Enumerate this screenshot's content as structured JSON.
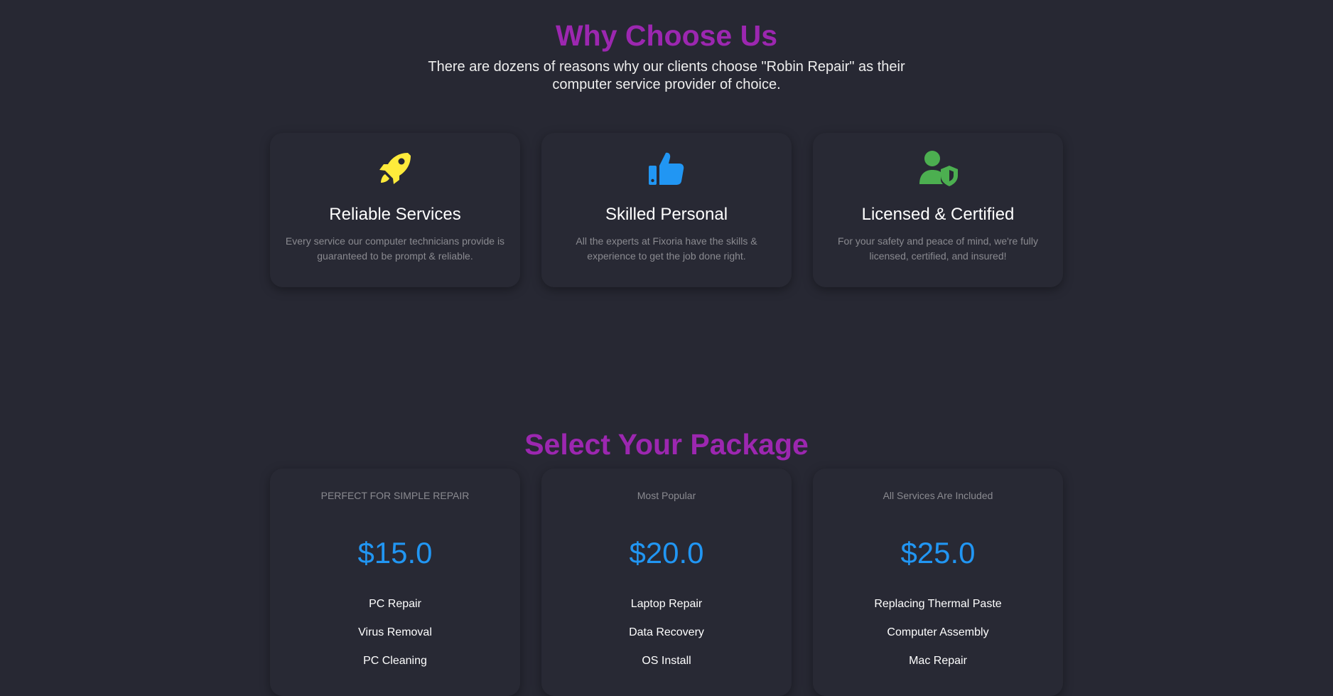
{
  "why_section": {
    "title": "Why Choose Us",
    "subtitle": "There are dozens of reasons why our clients choose \"Robin Repair\" as their computer service provider of choice.",
    "title_color": "#9c27b0",
    "features": [
      {
        "icon": "rocket-icon",
        "icon_color": "#ffeb3b",
        "title": "Reliable Services",
        "description": "Every service our computer technicians provide is guaranteed to be prompt & reliable."
      },
      {
        "icon": "thumbs-up-icon",
        "icon_color": "#2196f3",
        "title": "Skilled Personal",
        "description": "All the experts at Fixoria have the skills & experience to get the job done right."
      },
      {
        "icon": "user-shield-icon",
        "icon_color": "#4caf50",
        "title": "Licensed & Certified",
        "description": "For your safety and peace of mind, we're fully licensed, certified, and insured!"
      }
    ]
  },
  "packages_section": {
    "title": "Select Your Package",
    "price_color": "#2196f3",
    "packages": [
      {
        "tag": "PERFECT FOR SIMPLE REPAIR",
        "price": "$15.0",
        "features": [
          "PC Repair",
          "Virus Removal",
          "PC Cleaning"
        ]
      },
      {
        "tag": "Most Popular",
        "price": "$20.0",
        "features": [
          "Laptop Repair",
          "Data Recovery",
          "OS Install"
        ]
      },
      {
        "tag": "All Services Are Included",
        "price": "$25.0",
        "features": [
          "Replacing Thermal Paste",
          "Computer Assembly",
          "Mac Repair"
        ]
      }
    ]
  },
  "colors": {
    "background": "#272833",
    "card": "#282934",
    "muted_text": "#8a8a90"
  }
}
